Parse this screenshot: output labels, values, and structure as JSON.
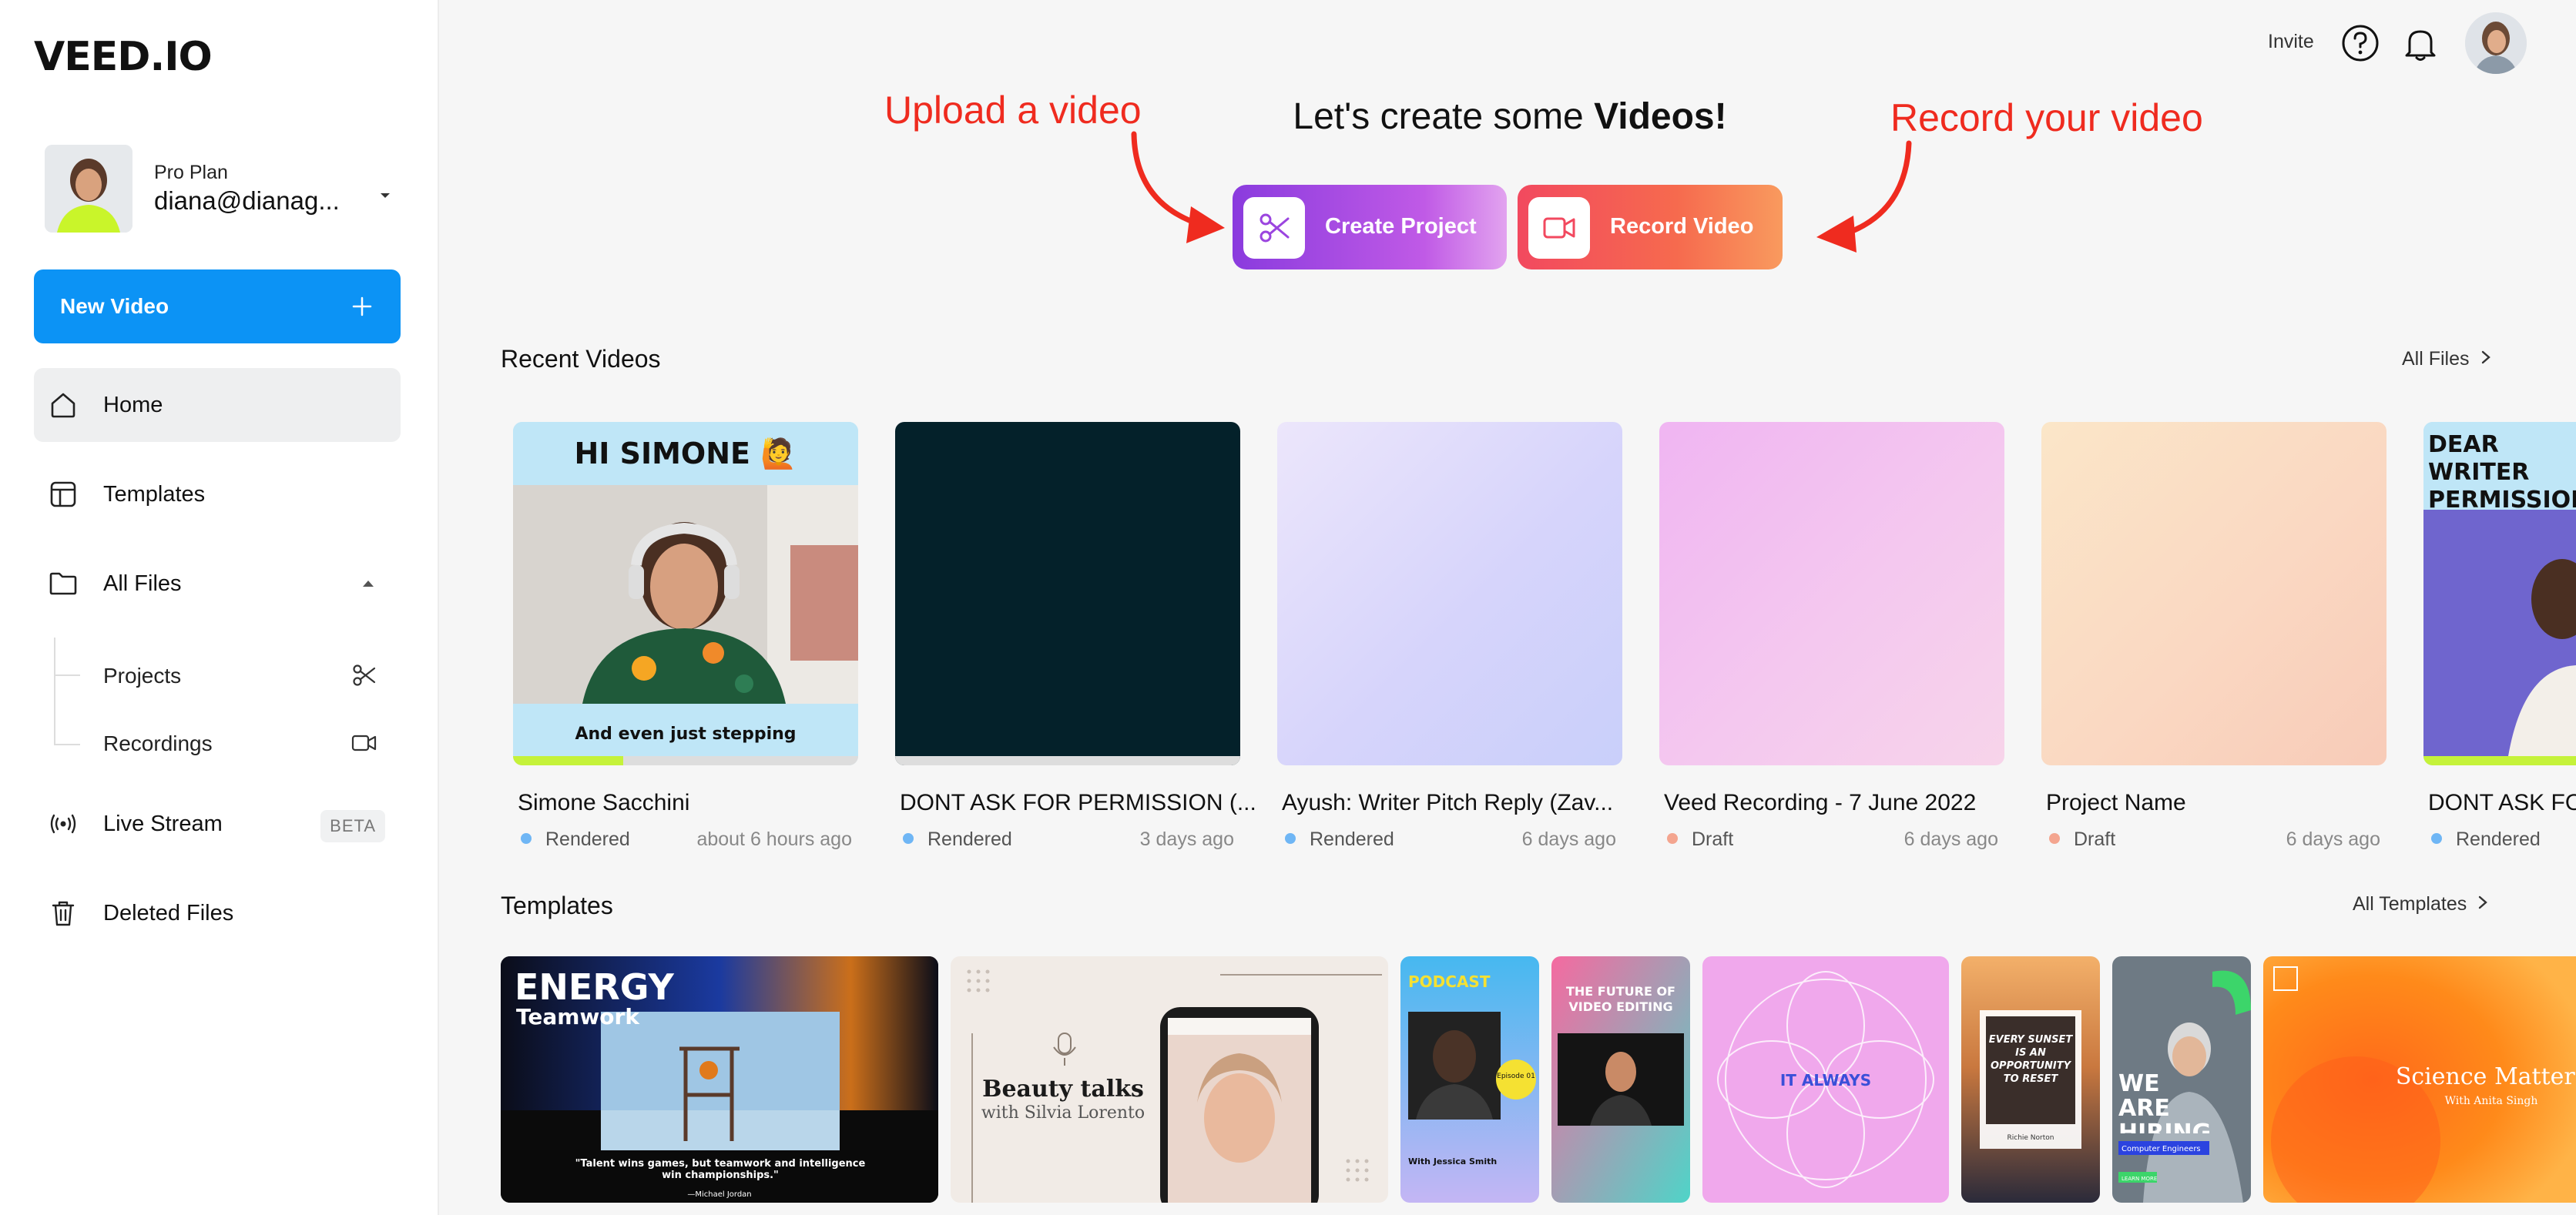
{
  "app": {
    "logo": "VEED.IO"
  },
  "account": {
    "plan": "Pro Plan",
    "email": "diana@dianag..."
  },
  "sidebar": {
    "new_video_label": "New Video",
    "items": [
      {
        "label": "Home"
      },
      {
        "label": "Templates"
      },
      {
        "label": "All Files"
      },
      {
        "label": "Projects"
      },
      {
        "label": "Recordings"
      },
      {
        "label": "Live Stream",
        "badge": "BETA"
      },
      {
        "label": "Deleted Files"
      }
    ]
  },
  "topbar": {
    "invite": "Invite"
  },
  "hero": {
    "headline_prefix": "Let's create some ",
    "headline_strong": "Videos!",
    "create_label": "Create Project",
    "record_label": "Record Video",
    "annotation_upload": "Upload a video",
    "annotation_record": "Record your video"
  },
  "recent": {
    "title": "Recent Videos",
    "link": "All Files",
    "cards": [
      {
        "name": "Simone Sacchini",
        "status": "Rendered",
        "time": "about 6 hours ago",
        "thumb_title": "HI SIMONE 🙋",
        "caption": "And even just stepping",
        "progress": 0.32
      },
      {
        "name": "DONT ASK FOR PERMISSION (...",
        "status": "Rendered",
        "time": "3 days ago"
      },
      {
        "name": "Ayush: Writer Pitch Reply (Zav...",
        "status": "Rendered",
        "time": "6 days ago"
      },
      {
        "name": "Veed Recording - 7 June 2022",
        "status": "Draft",
        "time": "6 days ago"
      },
      {
        "name": "Project Name",
        "status": "Draft",
        "time": "6 days ago"
      },
      {
        "name": "DONT ASK FO",
        "status": "Rendered",
        "time": "",
        "thumb_title": "DEAR WRITER PERMISSION TO"
      }
    ]
  },
  "templates": {
    "title": "Templates",
    "link": "All Templates",
    "items": [
      {
        "title": "ENERGY",
        "subtitle": "Teamwork",
        "quote": "\"Talent wins games, but teamwork and intelligence win championships.\"",
        "author": "—Michael Jordan"
      },
      {
        "title": "Beauty talks",
        "subtitle": "with Silvia Lorento"
      },
      {
        "title": "PODCAST",
        "host": "With Jessica Smith",
        "badge": "Episode 01"
      },
      {
        "title": "THE FUTURE OF VIDEO EDITING"
      },
      {
        "title": "IT ALWAYS"
      },
      {
        "title": "EVERY SUNSET IS AN OPPORTUNITY TO RESET",
        "author": "Richie Norton"
      },
      {
        "title": "WE ARE HIRING",
        "subtitle": "Computer Engineers",
        "cta": "LEARN MORE"
      },
      {
        "title": "Science Matters",
        "subtitle": "With Anita Singh"
      }
    ]
  },
  "colors": {
    "accent_blue": "#0c93f5",
    "annotation_red": "#ef2b1f",
    "rendered_dot": "#6fb6f5",
    "draft_dot": "#f4a58f"
  }
}
